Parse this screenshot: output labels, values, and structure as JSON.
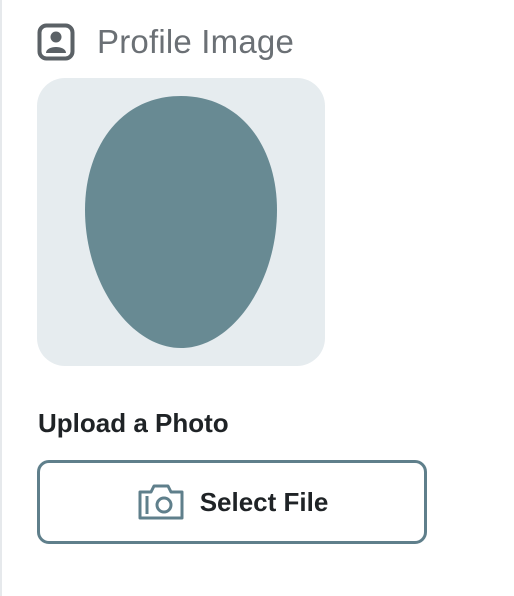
{
  "header": {
    "icon": "profile-card-icon",
    "title": "Profile Image"
  },
  "avatar": {
    "icon": "avatar-placeholder-icon",
    "background_color": "#e6ecef",
    "silhouette_color": "#688a93"
  },
  "upload": {
    "label": "Upload a Photo",
    "button_label": "Select File",
    "button_icon": "camera-icon",
    "accent_color": "#5f7f8b"
  }
}
